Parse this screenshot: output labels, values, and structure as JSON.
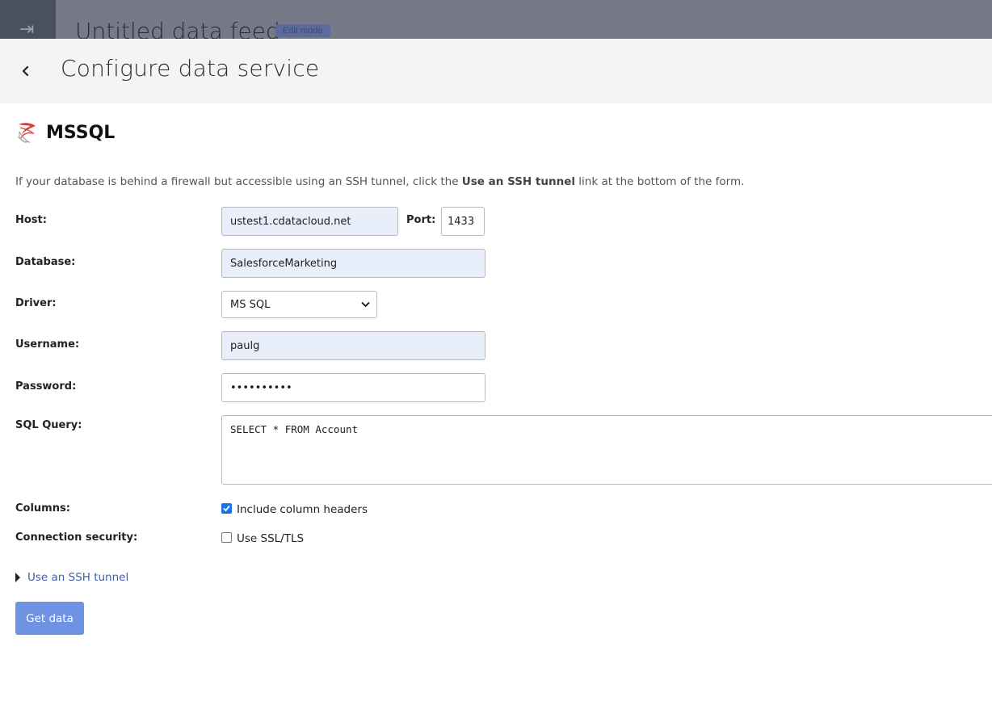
{
  "background": {
    "title": "Untitled data feed",
    "badge": "Edit mode",
    "sidebar_icon": "collapse-sidebar-icon"
  },
  "header": {
    "back_icon": "chevron-left-icon",
    "title": "Configure data service"
  },
  "source": {
    "icon": "mssql-logo-icon",
    "title": "MSSQL"
  },
  "hint": {
    "prefix": "If your database is behind a firewall but accessible using an SSH tunnel, click the ",
    "bold": "Use an SSH tunnel",
    "suffix": " link at the bottom of the form."
  },
  "form": {
    "host_label": "Host:",
    "host_value": "ustest1.cdatacloud.net",
    "port_label": "Port:",
    "port_value": "1433",
    "database_label": "Database:",
    "database_value": "SalesforceMarketing",
    "driver_label": "Driver:",
    "driver_value": "MS SQL",
    "username_label": "Username:",
    "username_value": "paulg",
    "password_label": "Password:",
    "password_value": "••••••••••",
    "query_label": "SQL Query:",
    "query_value": "SELECT * FROM Account",
    "columns_label": "Columns:",
    "columns_option": "Include column headers",
    "columns_checked": true,
    "security_label": "Connection security:",
    "security_option": "Use SSL/TLS",
    "security_checked": false
  },
  "ssh_link": "Use an SSH tunnel",
  "submit_label": "Get data",
  "colors": {
    "accent": "#1a73e8",
    "button": "#6f92e3",
    "link": "#3f5fa8",
    "filled_input": "#e8effb"
  }
}
